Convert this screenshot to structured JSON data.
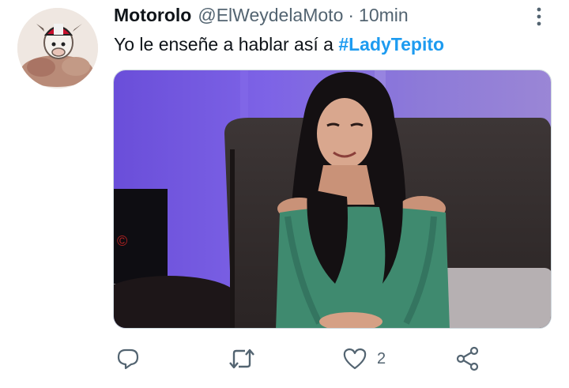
{
  "tweet": {
    "display_name": "Motorolo",
    "handle": "@ElWeydelaMoto",
    "separator": "·",
    "time": "10min",
    "text_prefix": "Yo le enseñe a hablar así a ",
    "hashtag": "#LadyTepito"
  },
  "media": {
    "description_icon": "photo-of-woman-in-green-sweater"
  },
  "actions": {
    "reply_icon": "reply-icon",
    "retweet_icon": "retweet-icon",
    "like_icon": "like-icon",
    "like_count": "2",
    "share_icon": "share-icon"
  },
  "colors": {
    "accent": "#1d9bf0",
    "secondary_text": "#536471",
    "primary_text": "#0f1419"
  }
}
